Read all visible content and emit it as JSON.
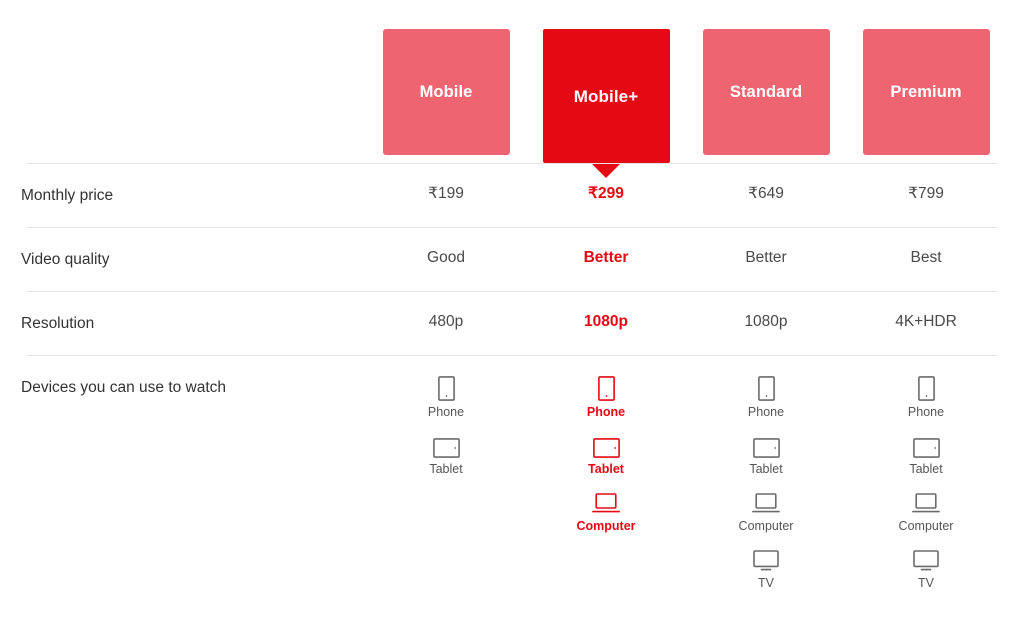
{
  "table": {
    "plans": [
      {
        "name": "Mobile",
        "selected": false
      },
      {
        "name": "Mobile+",
        "selected": true
      },
      {
        "name": "Standard",
        "selected": false
      },
      {
        "name": "Premium",
        "selected": false
      }
    ],
    "rows": [
      {
        "label": "Monthly price",
        "values": [
          "₹199",
          "₹299",
          "₹649",
          "₹799"
        ]
      },
      {
        "label": "Video quality",
        "values": [
          "Good",
          "Better",
          "Better",
          "Best"
        ]
      },
      {
        "label": "Resolution",
        "values": [
          "480p",
          "1080p",
          "1080p",
          "4K+HDR"
        ]
      }
    ],
    "devices_row": {
      "label": "Devices you can use to watch",
      "columns": [
        [
          {
            "icon": "phone-icon",
            "label": "Phone"
          },
          {
            "icon": "tablet-icon",
            "label": "Tablet"
          }
        ],
        [
          {
            "icon": "phone-icon",
            "label": "Phone"
          },
          {
            "icon": "tablet-icon",
            "label": "Tablet"
          },
          {
            "icon": "computer-icon",
            "label": "Computer"
          }
        ],
        [
          {
            "icon": "phone-icon",
            "label": "Phone"
          },
          {
            "icon": "tablet-icon",
            "label": "Tablet"
          },
          {
            "icon": "computer-icon",
            "label": "Computer"
          },
          {
            "icon": "tv-icon",
            "label": "TV"
          }
        ],
        [
          {
            "icon": "phone-icon",
            "label": "Phone"
          },
          {
            "icon": "tablet-icon",
            "label": "Tablet"
          },
          {
            "icon": "computer-icon",
            "label": "Computer"
          },
          {
            "icon": "tv-icon",
            "label": "TV"
          }
        ]
      ]
    },
    "colors": {
      "accent": "#E50914",
      "card": "#EE6571",
      "text": "#333333",
      "muted": "#4A4A4A",
      "divider": "#E6E6E6"
    }
  }
}
